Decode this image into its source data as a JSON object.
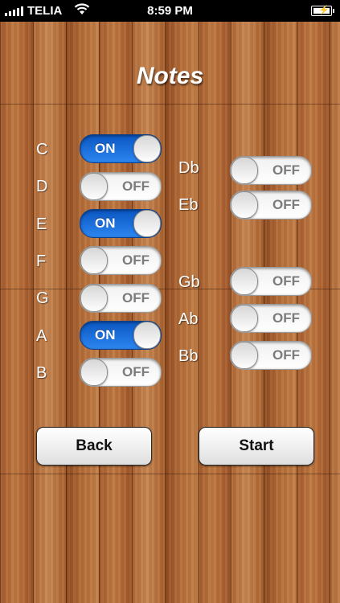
{
  "status_bar": {
    "carrier": "TELIA",
    "time": "8:59 PM",
    "signal_icon": "signal-bars-icon",
    "wifi_icon": "wifi-icon",
    "battery_icon": "battery-charging-icon"
  },
  "title": "Notes",
  "toggle_labels": {
    "on": "ON",
    "off": "OFF"
  },
  "natural_notes": [
    {
      "note": "C",
      "state": "ON"
    },
    {
      "note": "D",
      "state": "OFF"
    },
    {
      "note": "E",
      "state": "ON"
    },
    {
      "note": "F",
      "state": "OFF"
    },
    {
      "note": "G",
      "state": "OFF"
    },
    {
      "note": "A",
      "state": "ON"
    },
    {
      "note": "B",
      "state": "OFF"
    }
  ],
  "accidental_notes": [
    {
      "note": "Db",
      "state": "OFF"
    },
    {
      "note": "Eb",
      "state": "OFF"
    },
    {
      "note": "Gb",
      "state": "OFF"
    },
    {
      "note": "Ab",
      "state": "OFF"
    },
    {
      "note": "Bb",
      "state": "OFF"
    }
  ],
  "buttons": {
    "back": "Back",
    "start": "Start"
  },
  "colors": {
    "toggle_on": "#1f6fe0",
    "toggle_off": "#f5f5f5",
    "title": "#ffffff"
  }
}
